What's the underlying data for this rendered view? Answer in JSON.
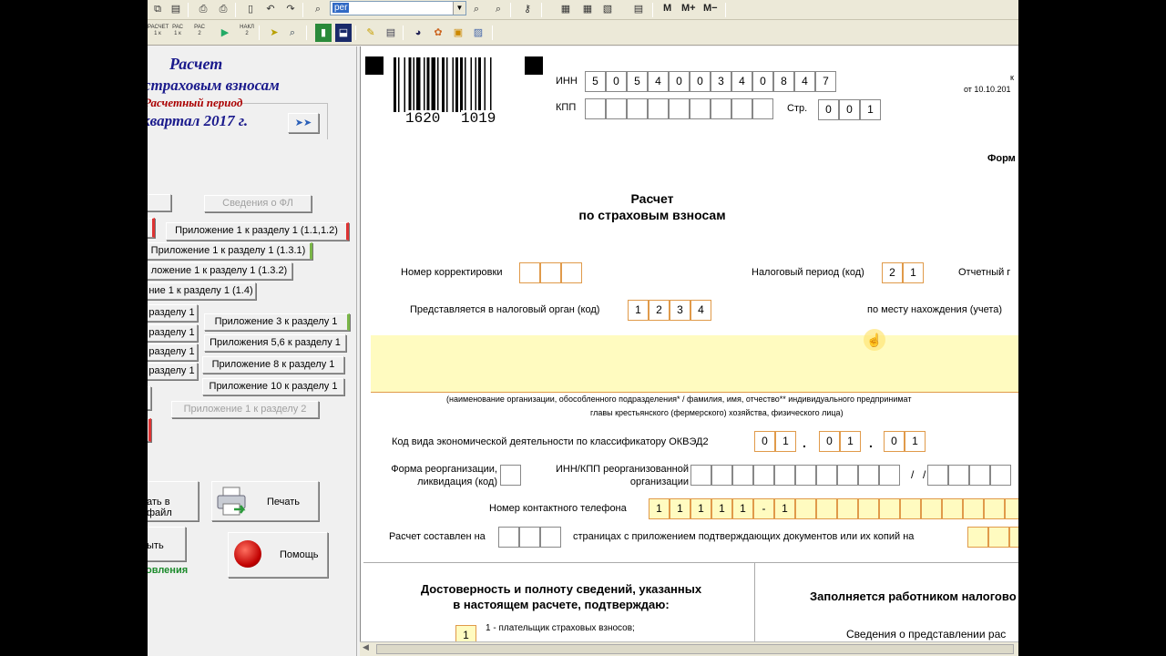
{
  "toolbar": {
    "combo_value": "per",
    "m_buttons": [
      "M",
      "M+",
      "M−"
    ],
    "mini_labels": [
      [
        "РАСЧЕТ",
        "1 к",
        ""
      ],
      [
        "РАС",
        "1 к",
        "2"
      ],
      [
        "РАС",
        "2",
        ""
      ],
      [
        "НАКЛ",
        "2",
        ""
      ]
    ]
  },
  "left": {
    "title1": "Расчет",
    "title2": "страховым взносам",
    "period_label": "Расчетный период",
    "period_value": "квартал 2017 г.",
    "btn_fl": "Сведения о ФЛ",
    "btn_app1_r1_11": "Приложение 1 к разделу 1  (1.1,1.2)",
    "btn_app1_r1_131": "Приложение 1 к разделу 1 (1.3.1)",
    "btn_app1_r1_132": "ложение 1 к разделу 1 (1.3.2)",
    "btn_app1_r1_14": "ние 1 к разделу 1 (1.4)",
    "btn_r1_a": "разделу 1",
    "btn_r1_b": "разделу 1",
    "btn_r1_c": "разделу 1",
    "btn_r1_d": "разделу 1",
    "btn_app3": "Приложение 3 к разделу 1",
    "btn_app56": "Приложения 5,6 к разделу 1",
    "btn_app8": "Приложение 8 к разделу 1",
    "btn_app10": "Приложение 10 к разделу 1",
    "btn_app1_r2": "Приложение 1 к разделу 2",
    "btn_file": "ать в файл",
    "btn_print": "Печать",
    "btn_exit": "ыть",
    "btn_help": "Помощь",
    "update_text": "овления"
  },
  "doc": {
    "barcode_num1": "1620",
    "barcode_num2": "1019",
    "inn_label": "ИНН",
    "inn": [
      "5",
      "0",
      "5",
      "4",
      "0",
      "0",
      "3",
      "4",
      "0",
      "8",
      "4",
      "7"
    ],
    "kpp_label": "КПП",
    "page_label": "Стр.",
    "page": [
      "0",
      "0",
      "1"
    ],
    "top_right_k": "к",
    "top_right_date": "от 10.10.201",
    "form_label": "Форм",
    "title1": "Расчет",
    "title2": "по страховым взносам",
    "correction_label": "Номер корректировки",
    "tax_period_label": "Налоговый период (код)",
    "tax_period": [
      "2",
      "1"
    ],
    "report_label": "Отчетный г",
    "tax_org_label": "Представляется в налоговый орган (код)",
    "tax_org": [
      "1",
      "2",
      "3",
      "4"
    ],
    "location_label": "по месту нахождения (учета)",
    "org_note1": "(наименование организации, обособленного подразделения* / фамилия, имя, отчество** индивидуального предпринимат",
    "org_note2": "главы крестьянского (фермерского) хозяйства, физического лица)",
    "okved_label": "Код вида экономической деятельности по классификатору ОКВЭД2",
    "okved": [
      "0",
      "1",
      "0",
      "1",
      "0",
      "1"
    ],
    "reorg_label1": "Форма реорганизации,",
    "reorg_label2": "ликвидация (код)",
    "reorg_inn_label1": "ИНН/КПП реорганизованной",
    "reorg_inn_label2": "организации",
    "phone_label": "Номер контактного телефона",
    "phone": [
      "1",
      "1",
      "1",
      "1",
      "1",
      "-",
      "1"
    ],
    "pages_label": "Расчет составлен на",
    "pages_label2": "страницах с приложением подтверждающих документов или их копий на",
    "confirm1": "Достоверность и полноту сведений, указанных",
    "confirm2": "в настоящем расчете, подтверждаю:",
    "payer_code": "1",
    "payer_text": "1 - плательщик страховых взносов;",
    "tax_officer": "Заполняется работником налогово",
    "submission": "Сведения о представлении рас"
  }
}
